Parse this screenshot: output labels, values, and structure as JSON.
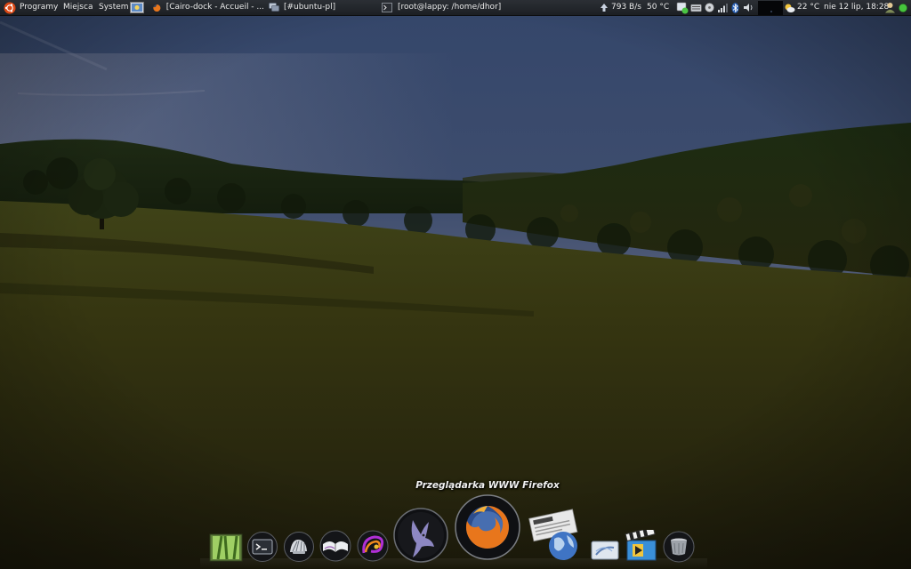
{
  "top_panel": {
    "menu": {
      "applications": "Programy",
      "places": "Miejsca",
      "system": "System"
    },
    "tasks": [
      {
        "label": "[Cairo-dock - Accueil - ...",
        "icon": "firefox-icon"
      },
      {
        "label": "[#ubuntu-pl]",
        "icon": "chat-icon"
      },
      {
        "label": "[root@lappy: /home/dhor]",
        "icon": "terminal-icon"
      }
    ],
    "network_speed": "793 B/s",
    "cpu_temp": "50 °C",
    "weather_temp": "22 °C",
    "clock": "nie 12 lip, 18:28"
  },
  "dock": {
    "tooltip": "Przeglądarka WWW Firefox",
    "launchers": [
      {
        "name": "bamboo-launcher",
        "icon": "bamboo-icon"
      },
      {
        "name": "terminal-launcher",
        "icon": "terminal-icon"
      },
      {
        "name": "seashell-launcher",
        "icon": "shell-icon"
      },
      {
        "name": "book-launcher",
        "icon": "book-icon"
      },
      {
        "name": "swirl-launcher",
        "icon": "swirl-icon"
      },
      {
        "name": "pidgin-launcher",
        "icon": "bird-icon"
      },
      {
        "name": "firefox-launcher",
        "icon": "firefox-icon"
      },
      {
        "name": "news-launcher",
        "icon": "news-globe-icon"
      },
      {
        "name": "drive-launcher",
        "icon": "drive-icon"
      },
      {
        "name": "media-launcher",
        "icon": "clapperboard-icon"
      },
      {
        "name": "trash-launcher",
        "icon": "trash-icon"
      }
    ]
  },
  "colors": {
    "panel": "#24282d",
    "sky_top": "#34476a",
    "sky_horizon": "#8d8a96",
    "grass": "#3b3a12",
    "firefox_orange": "#e8761c"
  }
}
